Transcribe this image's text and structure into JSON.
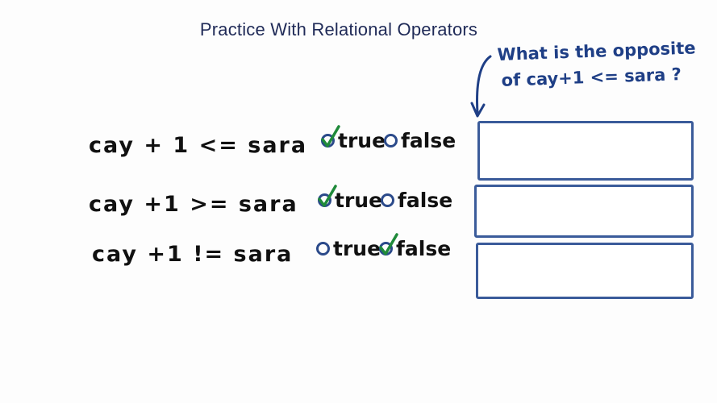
{
  "title": "Practice With Relational Operators",
  "note": {
    "line1": "What is the opposite",
    "line2": "of cay+1 <= sara ?"
  },
  "rows": [
    {
      "expression": "cay + 1 <= sara",
      "true_label": "true",
      "false_label": "false",
      "selected": "true",
      "answer": ""
    },
    {
      "expression": "cay +1 >= sara",
      "true_label": "true",
      "false_label": "false",
      "selected": "true",
      "answer": ""
    },
    {
      "expression": "cay +1 != sara",
      "true_label": "true",
      "false_label": "false",
      "selected": "false",
      "answer": ""
    }
  ],
  "colors": {
    "ink": "#111111",
    "note_blue": "#1f3f86",
    "box_blue": "#3a5b9a",
    "check_green": "#1f8a3a"
  }
}
